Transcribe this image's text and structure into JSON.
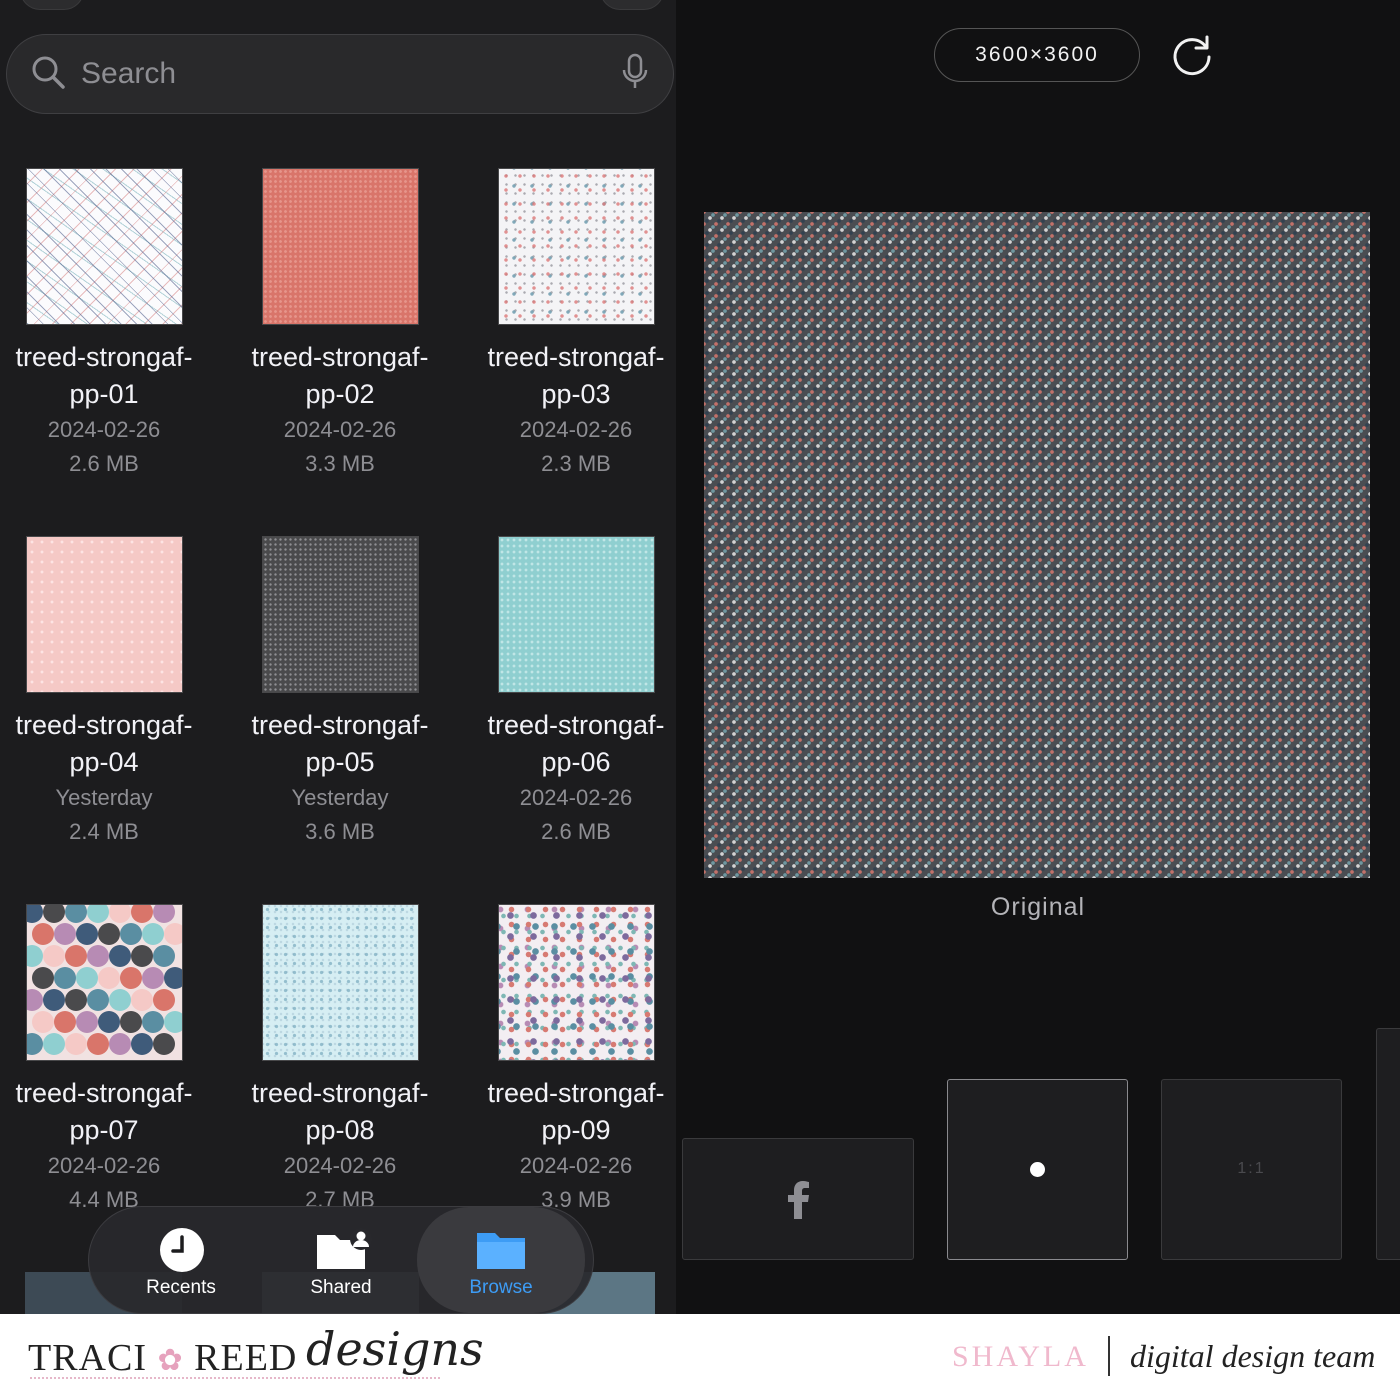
{
  "search": {
    "placeholder": "Search"
  },
  "files": [
    {
      "name_line1": "treed-strongaf-",
      "name_line2": "pp-01",
      "date": "2024-02-26",
      "size": "2.6 MB",
      "pattern": "p01"
    },
    {
      "name_line1": "treed-strongaf-",
      "name_line2": "pp-02",
      "date": "2024-02-26",
      "size": "3.3 MB",
      "pattern": "p02"
    },
    {
      "name_line1": "treed-strongaf-",
      "name_line2": "pp-03",
      "date": "2024-02-26",
      "size": "2.3 MB",
      "pattern": "p03"
    },
    {
      "name_line1": "treed-strongaf-",
      "name_line2": "pp-04",
      "date": "Yesterday",
      "size": "2.4 MB",
      "pattern": "p04"
    },
    {
      "name_line1": "treed-strongaf-",
      "name_line2": "pp-05",
      "date": "Yesterday",
      "size": "3.6 MB",
      "pattern": "p05"
    },
    {
      "name_line1": "treed-strongaf-",
      "name_line2": "pp-06",
      "date": "2024-02-26",
      "size": "2.6 MB",
      "pattern": "p06"
    },
    {
      "name_line1": "treed-strongaf-",
      "name_line2": "pp-07",
      "date": "2024-02-26",
      "size": "4.4 MB",
      "pattern": "p07"
    },
    {
      "name_line1": "treed-strongaf-",
      "name_line2": "pp-08",
      "date": "2024-02-26",
      "size": "2.7 MB",
      "pattern": "p08"
    },
    {
      "name_line1": "treed-strongaf-",
      "name_line2": "pp-09",
      "date": "2024-02-26",
      "size": "3.9 MB",
      "pattern": "p09"
    }
  ],
  "tabs": [
    {
      "label": "Recents",
      "icon": "clock-icon",
      "active": false
    },
    {
      "label": "Shared",
      "icon": "shared-folder-icon",
      "active": false
    },
    {
      "label": "Browse",
      "icon": "folder-icon",
      "active": true
    }
  ],
  "viewer": {
    "dimensions": "3600×3600",
    "caption": "Original",
    "options": [
      {
        "name": "facebook-option",
        "icon": "facebook-icon",
        "label": ""
      },
      {
        "name": "original-option",
        "icon": "dot-icon",
        "label": ""
      },
      {
        "name": "square-option",
        "icon": "",
        "label": "1:1"
      }
    ]
  },
  "footer": {
    "brand": "TRACI",
    "brand2": "REED",
    "brand_script": "designs",
    "designer": "SHAYLA",
    "team": "digital design team"
  },
  "colors": {
    "accent": "#3d9cf5",
    "background": "#1c1c1e",
    "pink": "#f0b9cd"
  }
}
